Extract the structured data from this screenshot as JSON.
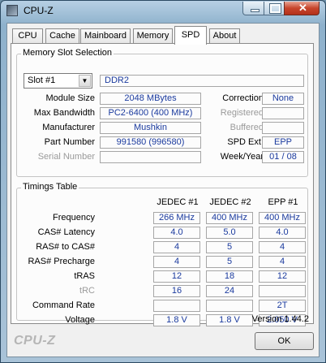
{
  "window": {
    "title": "CPU-Z"
  },
  "tabs": [
    "CPU",
    "Cache",
    "Mainboard",
    "Memory",
    "SPD",
    "About"
  ],
  "active_tab": "SPD",
  "memory_slot": {
    "group_title": "Memory Slot Selection",
    "slot": "Slot #1",
    "type": "DDR2",
    "module_size_label": "Module Size",
    "module_size": "2048 MBytes",
    "max_bandwidth_label": "Max Bandwidth",
    "max_bandwidth": "PC2-6400 (400 MHz)",
    "manufacturer_label": "Manufacturer",
    "manufacturer": "Mushkin",
    "part_number_label": "Part Number",
    "part_number": "991580 (996580)",
    "serial_number_label": "Serial Number",
    "serial_number": "",
    "correction_label": "Correction",
    "correction": "None",
    "registered_label": "Registered",
    "registered": "",
    "buffered_label": "Buffered",
    "buffered": "",
    "spd_ext_label": "SPD Ext.",
    "spd_ext": "EPP",
    "week_year_label": "Week/Year",
    "week_year": "01 / 08"
  },
  "timings": {
    "group_title": "Timings Table",
    "columns": [
      "JEDEC #1",
      "JEDEC #2",
      "EPP #1"
    ],
    "rows": [
      {
        "label": "Frequency",
        "values": [
          "266 MHz",
          "400 MHz",
          "400 MHz"
        ],
        "dim": false
      },
      {
        "label": "CAS# Latency",
        "values": [
          "4.0",
          "5.0",
          "4.0"
        ],
        "dim": false
      },
      {
        "label": "RAS# to CAS#",
        "values": [
          "4",
          "5",
          "4"
        ],
        "dim": false
      },
      {
        "label": "RAS# Precharge",
        "values": [
          "4",
          "5",
          "4"
        ],
        "dim": false
      },
      {
        "label": "tRAS",
        "values": [
          "12",
          "18",
          "12"
        ],
        "dim": false
      },
      {
        "label": "tRC",
        "values": [
          "16",
          "24",
          ""
        ],
        "dim": true
      },
      {
        "label": "Command Rate",
        "values": [
          "",
          "",
          "2T"
        ],
        "dim": false
      },
      {
        "label": "Voltage",
        "values": [
          "1.8 V",
          "1.8 V",
          "2.050 V"
        ],
        "dim": false
      }
    ]
  },
  "footer": {
    "version": "Version 1.44.2",
    "brand": "CPU-Z",
    "ok_label": "OK"
  }
}
